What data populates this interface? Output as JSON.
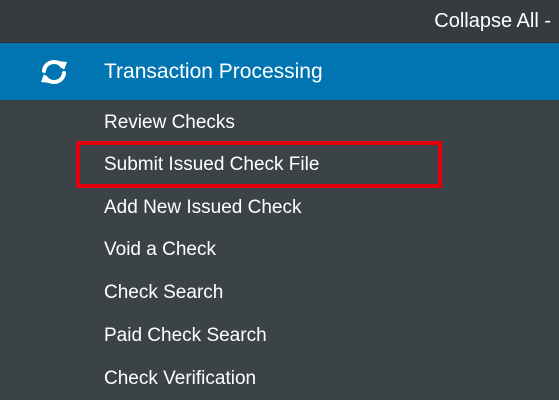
{
  "toolbar": {
    "collapse_all_label": "Collapse All -"
  },
  "section": {
    "title": "Transaction Processing",
    "icon": "refresh-icon",
    "background_color": "#0075b2"
  },
  "menu": {
    "items": [
      {
        "label": "Review Checks"
      },
      {
        "label": "Submit Issued Check File",
        "highlighted": true
      },
      {
        "label": "Add New Issued Check"
      },
      {
        "label": "Void a Check"
      },
      {
        "label": "Check Search"
      },
      {
        "label": "Paid Check Search"
      },
      {
        "label": "Check Verification"
      }
    ]
  },
  "colors": {
    "panel_background": "#3c4347",
    "highlight_border": "#e3000f",
    "text": "#ffffff"
  }
}
